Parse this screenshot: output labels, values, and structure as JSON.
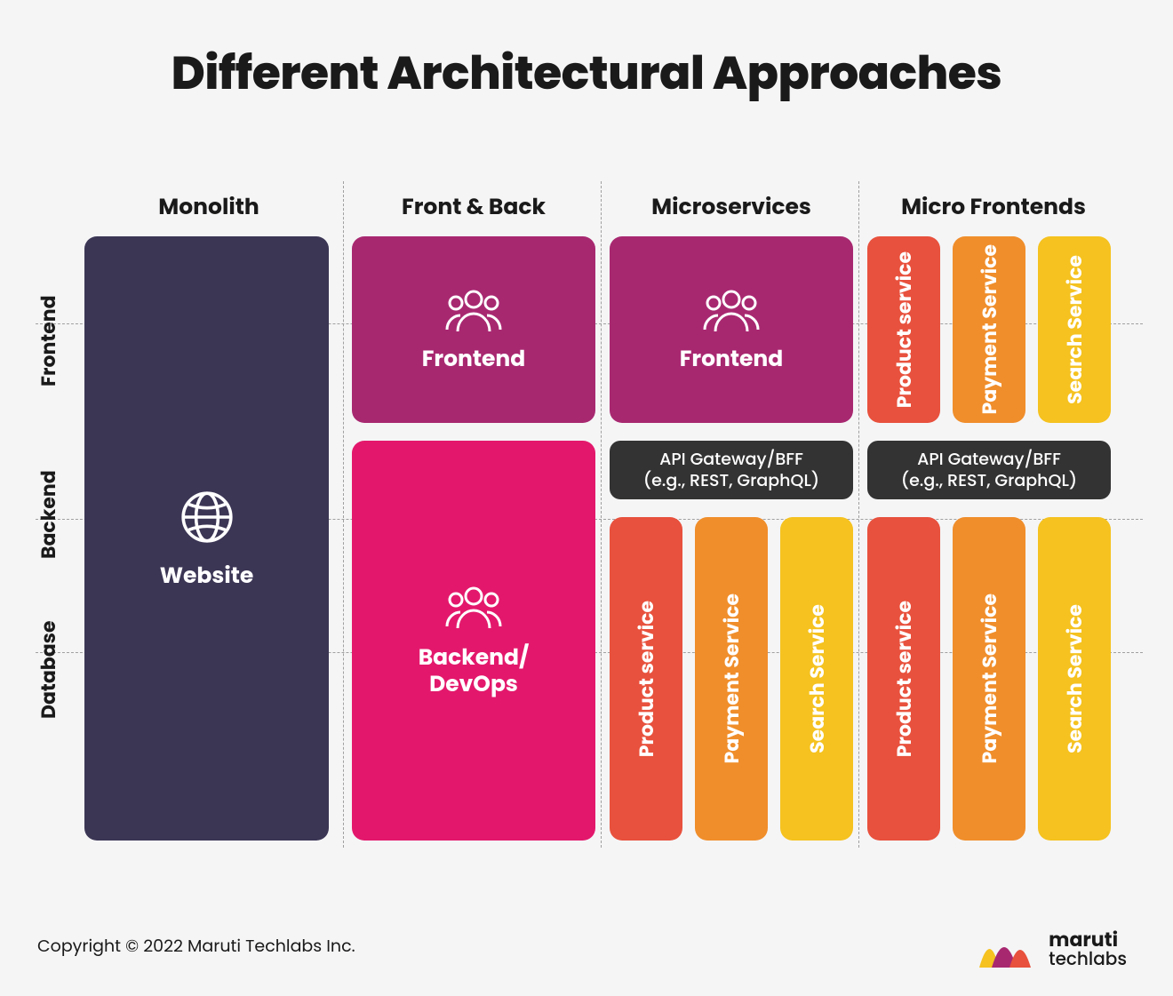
{
  "title": "Different Architectural Approaches",
  "columns": [
    {
      "label": "Monolith"
    },
    {
      "label": "Front & Back"
    },
    {
      "label": "Microservices"
    },
    {
      "label": "Micro Frontends"
    }
  ],
  "rows": [
    {
      "label": "Frontend"
    },
    {
      "label": "Backend"
    },
    {
      "label": "Database"
    }
  ],
  "monolith": {
    "label": "Website"
  },
  "frontback": {
    "frontend": "Frontend",
    "backend": "Backend/\nDevOps"
  },
  "microservices": {
    "frontend": "Frontend",
    "gateway": {
      "line1": "API Gateway/BFF",
      "line2": "(e.g., REST, GraphQL)"
    },
    "services": [
      {
        "label": "Product service",
        "color": "#e8513d"
      },
      {
        "label": "Payment Service",
        "color": "#f08e2b"
      },
      {
        "label": "Search Service",
        "color": "#f5c21f"
      }
    ]
  },
  "microfrontends": {
    "frontends": [
      {
        "label": "Product service",
        "color": "#e8513d"
      },
      {
        "label": "Payment Service",
        "color": "#f08e2b"
      },
      {
        "label": "Search Service",
        "color": "#f5c21f"
      }
    ],
    "gateway": {
      "line1": "API Gateway/BFF",
      "line2": "(e.g., REST, GraphQL)"
    },
    "services": [
      {
        "label": "Product service",
        "color": "#e8513d"
      },
      {
        "label": "Payment Service",
        "color": "#f08e2b"
      },
      {
        "label": "Search Service",
        "color": "#f5c21f"
      }
    ]
  },
  "footer": {
    "copyright": "Copyright © 2022 Maruti Techlabs Inc.",
    "brand_line1": "maruti",
    "brand_line2": "techlabs"
  },
  "colors": {
    "purple": "#3c3655",
    "magenta_dark": "#a82870",
    "magenta": "#e3186c",
    "orange_red": "#e8513d",
    "orange": "#f08e2b",
    "yellow": "#f5c21f",
    "dark": "#333333"
  }
}
